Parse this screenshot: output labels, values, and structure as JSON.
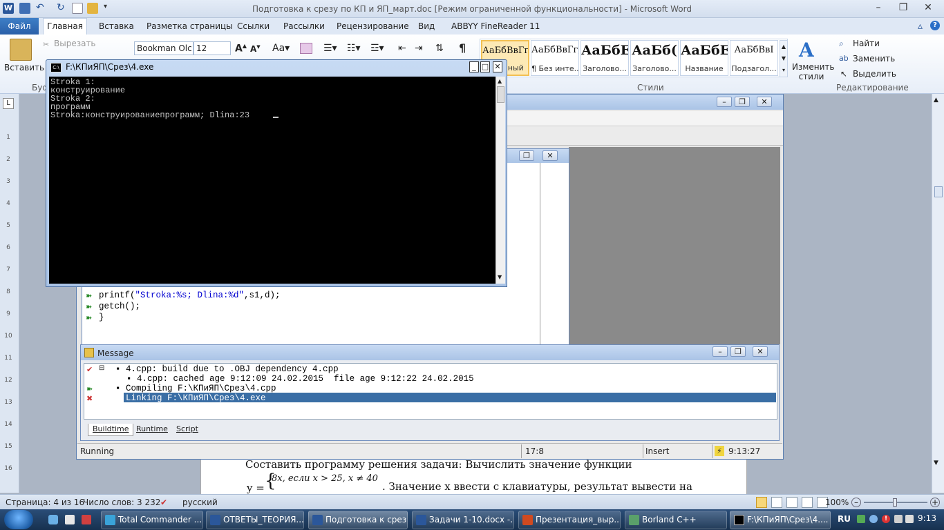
{
  "word": {
    "title": "Подготовка к срезу по КП и ЯП_март.doc [Режим ограниченной функциональности]  -  Microsoft Word",
    "tabs": [
      "Файл",
      "Главная",
      "Вставка",
      "Разметка страницы",
      "Ссылки",
      "Рассылки",
      "Рецензирование",
      "Вид",
      "ABBYY FineReader 11"
    ],
    "clipboard": {
      "paste": "Вставить",
      "cut": "Вырезать",
      "group": "Буф"
    },
    "font": {
      "name": "Bookman Olc",
      "size": "12"
    },
    "styles": [
      {
        "sample": "АаБбВвГг,",
        "name": "Обычный"
      },
      {
        "sample": "АаБбВвГг,",
        "name": "¶ Без инте..."
      },
      {
        "sample": "АаБбЕ",
        "name": "Заголово..."
      },
      {
        "sample": "АаБб(",
        "name": "Заголово..."
      },
      {
        "sample": "АаБбЕ",
        "name": "Название"
      },
      {
        "sample": "АаБбВвI",
        "name": "Подзагол..."
      }
    ],
    "change_styles": "Изменить стили",
    "styles_group": "Стили",
    "editing": {
      "find": "Найти",
      "replace": "Заменить",
      "select": "Выделить",
      "group": "Редактирование"
    },
    "doc_text": {
      "line1": "Составить     программу     решения     задачи:     Вычислить     значение     функции",
      "y_eq": "y =",
      "piece1": "8x,  если  x > 25, x ≠ 40",
      "line2": ". Значение  х  ввести  с клавиатуры,   результат вывести на"
    },
    "status": {
      "page": "Страница: 4 из 16",
      "words": "Число слов: 3 232",
      "lang": "русский",
      "zoom": "100%"
    }
  },
  "ruler_labels": [
    "1",
    "2",
    "3",
    "4",
    "5",
    "6",
    "7",
    "8",
    "9",
    "10",
    "11",
    "12",
    "13",
    "14",
    "15",
    "16"
  ],
  "console": {
    "title": "F:\\КПиЯП\\Срез\\4.exe",
    "lines": [
      "Stroka 1:",
      "конструирование",
      "Stroka 2:",
      "программ",
      "Stroka:конструированиепрограмм; Dlina:23"
    ]
  },
  "editor": {
    "line1_pre": "printf(",
    "line1_str": "\"Stroka:%s; Dlina:%d\"",
    "line1_post": ",s1,d);",
    "line2": "getch();",
    "line3": "}"
  },
  "message": {
    "title": "Message",
    "lines": [
      "4.cpp: build due to .OBJ dependency 4.cpp",
      "4.cpp: cached age 9:12:09 24.02.2015  file age 9:12:22 24.02.2015",
      "Compiling F:\\КПиЯП\\Срез\\4.cpp",
      "Linking F:\\КПиЯП\\Срез\\4.exe"
    ],
    "tabs": [
      "Buildtime",
      "Runtime",
      "Script"
    ]
  },
  "ide_status": {
    "state": "Running",
    "pos": "17:8",
    "mode": "Insert",
    "time": "9:13:27"
  },
  "taskbar": {
    "items": [
      "Total Commander ...",
      "ОТВЕТЫ_ТЕОРИЯ....",
      "Подготовка к срез...",
      "Задачи 1-10.docx -...",
      "Презентация_выр...",
      "Borland C++",
      "F:\\КПиЯП\\Срез\\4...."
    ],
    "lang": "RU",
    "clock": "9:13"
  },
  "colors": {
    "word_blue": "#2b579a",
    "console_bg": "#000000",
    "highlight": "#3a6ea5"
  }
}
